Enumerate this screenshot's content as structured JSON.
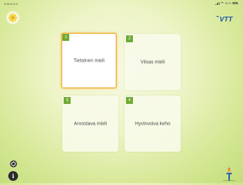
{
  "status_bar": {
    "time": "9:35",
    "date": "to 8.4.",
    "battery": "26 %"
  },
  "header": {
    "logo_text": "VTT"
  },
  "cards": [
    {
      "number": "1",
      "label": "Tietoinen mieli",
      "selected": true
    },
    {
      "number": "2",
      "label": "Viisas mieli",
      "selected": false
    },
    {
      "number": "3",
      "label": "Arvostava mieli",
      "selected": false
    },
    {
      "number": "4",
      "label": "Hyvinvoiva keho",
      "selected": false
    }
  ],
  "footer": {
    "info_label": "i"
  },
  "colors": {
    "number_badge": "#6faa32",
    "selected_border": "#f2c05a",
    "vtt_blue": "#1d5aa8",
    "background_light": "#f6f9e2",
    "background_dark": "#c3dd7a"
  },
  "icons": {
    "top_left": "flower-logo-icon",
    "top_right": "vtt-logo-icon",
    "settings": "settings-icon",
    "info": "info-icon",
    "bottom_right": "torch-logo-icon"
  }
}
